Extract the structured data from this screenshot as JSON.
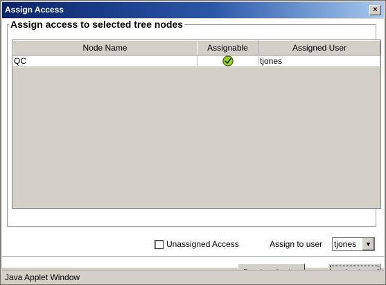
{
  "window": {
    "title": "Assign Access",
    "close_symbol": "×",
    "status_text": "Java Applet Window"
  },
  "group": {
    "legend": "Assign access to selected tree nodes"
  },
  "table": {
    "headers": [
      "Node Name",
      "Assignable",
      "Assigned User"
    ],
    "rows": [
      {
        "node_name": "QC",
        "assignable": true,
        "assignable_icon": "green-check-circle-icon",
        "assigned_user": "tjones"
      }
    ]
  },
  "controls": {
    "unassigned_checkbox_label": "Unassigned Access",
    "unassigned_checked": false,
    "assign_to_user_label": "Assign to user",
    "assign_to_user_value": "tjones"
  },
  "buttons": {
    "preview": "Preview Assign",
    "apply": "Apply"
  },
  "colors": {
    "titlebar_start": "#0a246a",
    "titlebar_end": "#a6caf0",
    "check_green": "#9ed12a"
  }
}
